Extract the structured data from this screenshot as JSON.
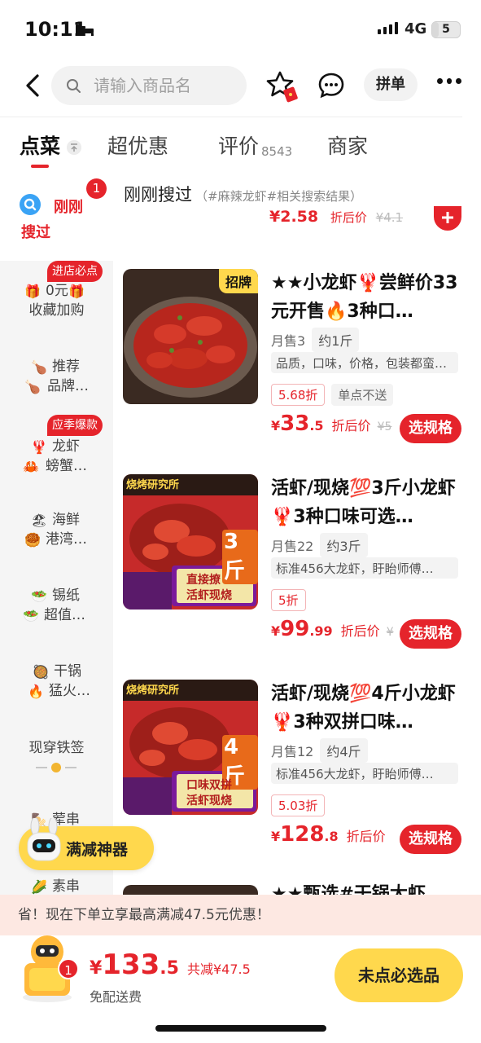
{
  "status": {
    "time": "10:11",
    "network": "4G",
    "battery": "5"
  },
  "search": {
    "placeholder": "请输入商品名"
  },
  "nav": {
    "group_label": "拼单"
  },
  "tabs": [
    {
      "label": "点菜"
    },
    {
      "label": "超优惠"
    },
    {
      "label": "评价",
      "count": "8543"
    },
    {
      "label": "商家"
    }
  ],
  "sidebar": {
    "first": {
      "label1": "刚刚",
      "label2": "搜过",
      "badge": "1"
    },
    "items": [
      {
        "badge": "进店必点",
        "label1": "0元",
        "label2": "收藏加购"
      },
      {
        "label1": "推荐",
        "label2": "品牌…"
      },
      {
        "badge": "应季爆款",
        "label1": "龙虾",
        "label2": "螃蟹…"
      },
      {
        "label1": "海鲜",
        "label2": "港湾…"
      },
      {
        "label1": "锡纸",
        "label2": "超值…"
      },
      {
        "label1": "干锅",
        "label2": "猛火…"
      },
      {
        "label1": "现穿铁签",
        "label2": ""
      },
      {
        "label1": "荤串",
        "label2": ""
      },
      {
        "label1": "素串",
        "label2": ""
      }
    ]
  },
  "section": {
    "title": "刚刚搜过",
    "subtitle": "（#麻辣龙虾#相关搜索结果）"
  },
  "partial_row": {
    "price": "¥2.58",
    "label": "折后价",
    "orig": "¥4.1"
  },
  "products": [
    {
      "corner": "招牌",
      "title": "★★小龙虾🦞尝鲜价33元开售🔥3种口…",
      "sales": "月售3",
      "weight": "约1斤",
      "desc": "品质，口味，价格，包装都蛮…",
      "discount": "5.68折",
      "extra_tag": "单点不送",
      "price_int": "33",
      "price_dec": ".5",
      "price_label": "折后价",
      "price_orig": "¥5",
      "btn": "选规格",
      "banner_top": "",
      "banner_big": "",
      "banner_box1": "",
      "banner_box2": ""
    },
    {
      "corner": "",
      "title": "活虾/现烧💯3斤小龙虾🦞3种口味可选…",
      "sales": "月售22",
      "weight": "约3斤",
      "desc": "标准456大龙虾，盱眙师傅…",
      "discount": "5折",
      "extra_tag": "",
      "price_int": "99",
      "price_dec": ".99",
      "price_label": "折后价",
      "price_orig": "¥",
      "btn": "选规格",
      "banner_top": "烧烤研究所",
      "banner_big": "3斤",
      "banner_box1": "直接撩",
      "banner_box2": "活虾现烧"
    },
    {
      "corner": "",
      "title": "活虾/现烧💯4斤小龙虾🦞3种双拼口味…",
      "sales": "月售12",
      "weight": "约4斤",
      "desc": "标准456大龙虾，盱眙师傅…",
      "discount": "5.03折",
      "extra_tag": "",
      "price_int": "128",
      "price_dec": ".8",
      "price_label": "折后价",
      "price_orig": "",
      "btn": "选规格",
      "banner_top": "烧烤研究所",
      "banner_big": "4斤",
      "banner_box1": "口味双拼",
      "banner_box2": "活虾现烧"
    }
  ],
  "next_product_title": "★★甄选#干锅大虾",
  "float_btn": {
    "label": "满减神器"
  },
  "promo": {
    "text": "省！现在下单立享最高满减47.5元优惠！"
  },
  "cart": {
    "badge": "1",
    "price_sym": "¥",
    "price_int": "133",
    "price_dec": ".5",
    "discount": "共减¥47.5",
    "delivery": "免配送费",
    "checkout": "未点必选品"
  },
  "colors": {
    "accent": "#e5242b",
    "yellow": "#ffd84d",
    "promo_bg": "#fde8e2"
  }
}
